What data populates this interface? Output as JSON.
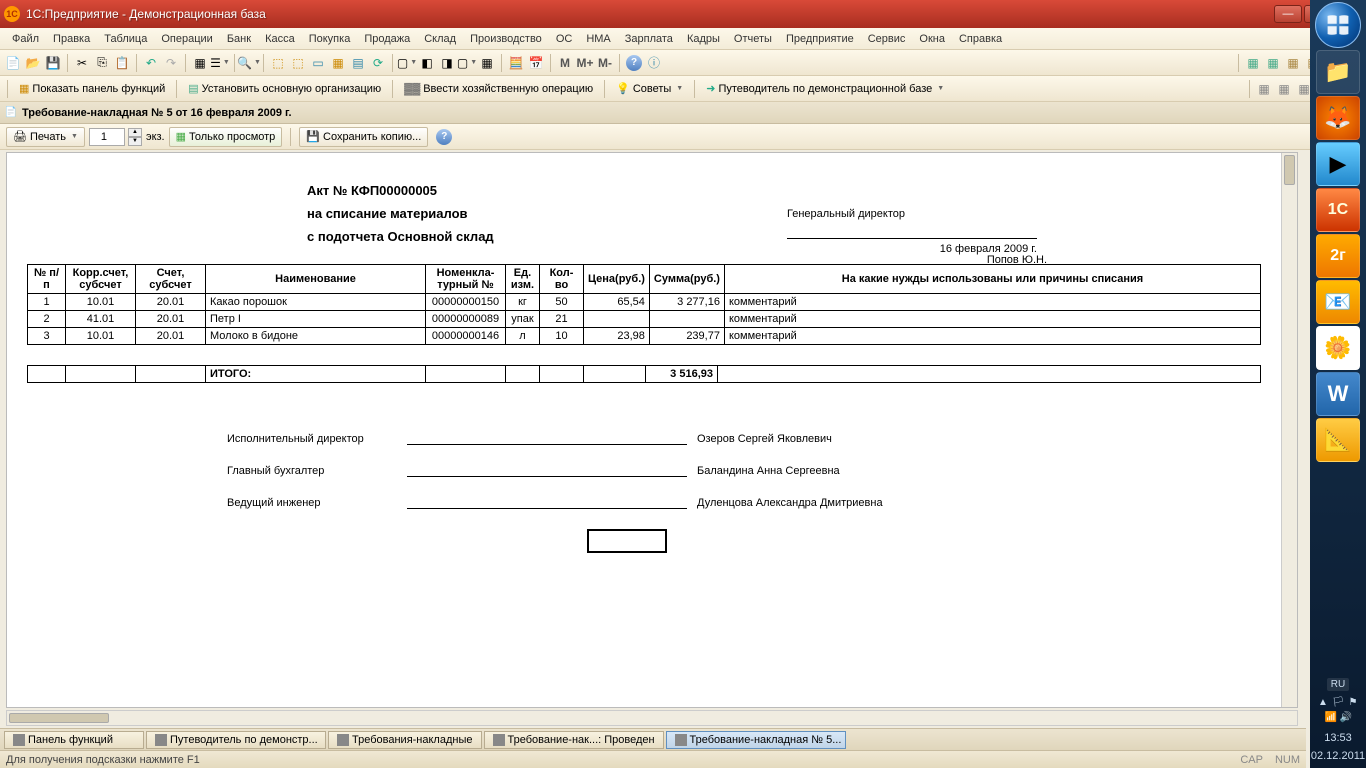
{
  "window": {
    "title": "1С:Предприятие - Демонстрационная база"
  },
  "menubar": [
    "Файл",
    "Правка",
    "Таблица",
    "Операции",
    "Банк",
    "Касса",
    "Покупка",
    "Продажа",
    "Склад",
    "Производство",
    "ОС",
    "НМА",
    "Зарплата",
    "Кадры",
    "Отчеты",
    "Предприятие",
    "Сервис",
    "Окна",
    "Справка"
  ],
  "toolbar2": {
    "show_panel": "Показать панель функций",
    "set_org": "Установить основную организацию",
    "enter_op": "Ввести хозяйственную операцию",
    "tips": "Советы",
    "guide": "Путеводитель по демонстрационной базе"
  },
  "doc_tab": {
    "title": "Требование-накладная № 5 от 16 февраля 2009 г."
  },
  "doc_toolbar": {
    "print": "Печать",
    "copies": "1",
    "copies_label": "экз.",
    "preview": "Только просмотр",
    "save_copy": "Сохранить копию..."
  },
  "document": {
    "act_no": "Акт № КФП00000005",
    "line2": "на списание материалов",
    "line3": "с подотчета Основной склад",
    "approver_role": "Генеральный директор",
    "approver_name": "Попов Ю.Н.",
    "approve_date": "16 февраля 2009 г.",
    "headers": {
      "num": "№ п/п",
      "corr": "Корр.счет, субсчет",
      "acct": "Счет, субсчет",
      "name": "Наименование",
      "nomen": "Номенкла-турный №",
      "unit": "Ед. изм.",
      "qty": "Кол-во",
      "price": "Цена(руб.)",
      "sum": "Сумма(руб.)",
      "purpose": "На какие нужды использованы или причины списания"
    },
    "rows": [
      {
        "n": "1",
        "corr": "10.01",
        "acct": "20.01",
        "name": "Какао порошок",
        "nomen": "00000000150",
        "unit": "кг",
        "qty": "50",
        "price": "65,54",
        "sum": "3 277,16",
        "purpose": "комментарий"
      },
      {
        "n": "2",
        "corr": "41.01",
        "acct": "20.01",
        "name": "Петр I",
        "nomen": "00000000089",
        "unit": "упак",
        "qty": "21",
        "price": "",
        "sum": "",
        "purpose": "комментарий"
      },
      {
        "n": "3",
        "corr": "10.01",
        "acct": "20.01",
        "name": "Молоко в бидоне",
        "nomen": "00000000146",
        "unit": "л",
        "qty": "10",
        "price": "23,98",
        "sum": "239,77",
        "purpose": "комментарий"
      }
    ],
    "total_label": "ИТОГО:",
    "total_sum": "3 516,93",
    "signatures": [
      {
        "role": "Исполнительный директор",
        "name": "Озеров Сергей Яковлевич"
      },
      {
        "role": "Главный бухгалтер",
        "name": "Баландина Анна Сергеевна"
      },
      {
        "role": "Ведущий инженер",
        "name": "Дуленцова Александра Дмитриевна"
      }
    ]
  },
  "taskbar": [
    {
      "label": "Панель функций",
      "active": false
    },
    {
      "label": "Путеводитель по демонстр...",
      "active": false
    },
    {
      "label": "Требования-накладные",
      "active": false
    },
    {
      "label": "Требование-нак...: Проведен",
      "active": false
    },
    {
      "label": "Требование-накладная № 5...",
      "active": true
    }
  ],
  "statusbar": {
    "hint": "Для получения подсказки нажмите F1",
    "cap": "CAP",
    "num": "NUM"
  },
  "tray": {
    "lang": "RU",
    "time": "13:53",
    "date": "02.12.2011"
  }
}
